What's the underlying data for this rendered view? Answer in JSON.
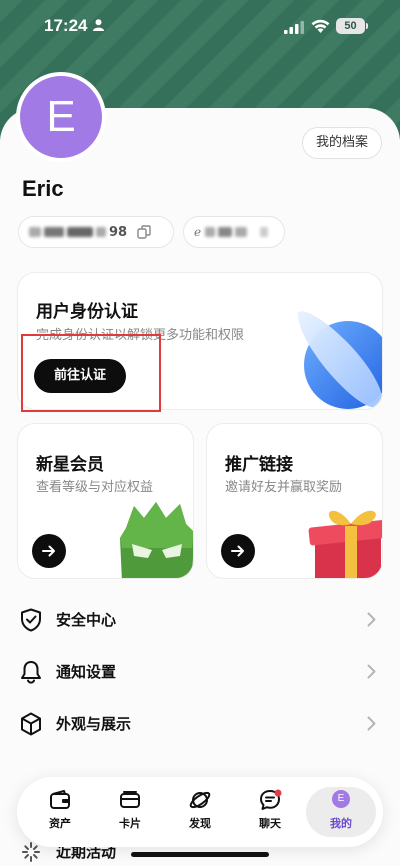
{
  "status_bar": {
    "time": "17:24",
    "battery": "50"
  },
  "profile": {
    "avatar_initial": "E",
    "username": "Eric",
    "profile_button": "我的档案",
    "id_suffix": "98"
  },
  "verify_card": {
    "title": "用户身份认证",
    "subtitle": "完成身份认证以解锁更多功能和权限",
    "button": "前往认证"
  },
  "member_card": {
    "title": "新星会员",
    "subtitle": "查看等级与对应权益"
  },
  "promo_card": {
    "title": "推广链接",
    "subtitle": "邀请好友并赢取奖励"
  },
  "menu": [
    {
      "label": "安全中心",
      "icon": "shield-icon"
    },
    {
      "label": "通知设置",
      "icon": "bell-icon"
    },
    {
      "label": "外观与展示",
      "icon": "cube-icon"
    },
    {
      "label": "",
      "icon": "link-icon"
    },
    {
      "label": "近期活动",
      "icon": "loading-icon"
    }
  ],
  "tabbar": [
    {
      "label": "资产",
      "icon": "wallet-icon"
    },
    {
      "label": "卡片",
      "icon": "card-icon"
    },
    {
      "label": "发现",
      "icon": "planet-icon"
    },
    {
      "label": "聊天",
      "icon": "chat-icon"
    },
    {
      "label": "我的",
      "icon": "avatar-icon",
      "active": true
    }
  ],
  "colors": {
    "accent": "#a27ae6",
    "header": "#3f7a63",
    "highlight": "#e03b3b"
  }
}
